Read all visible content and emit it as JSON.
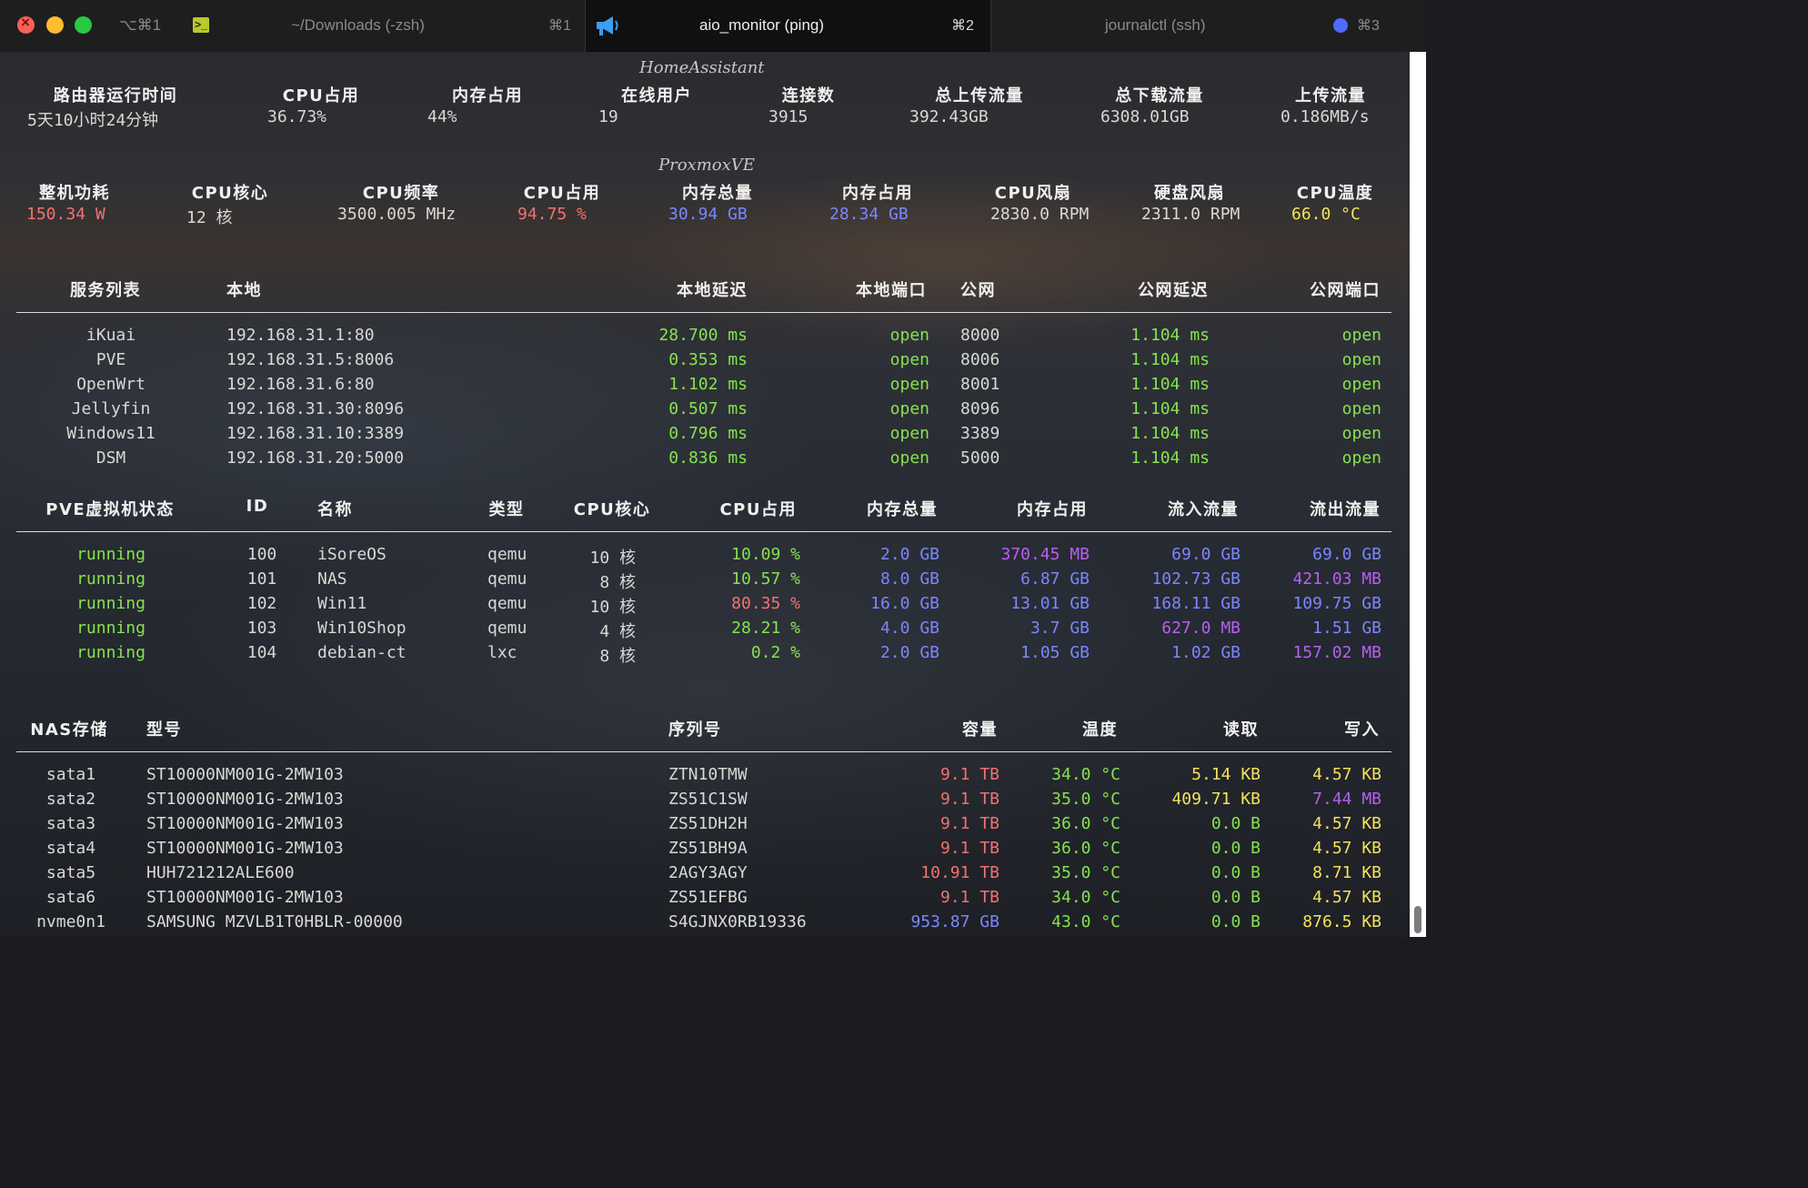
{
  "window": {
    "shortcut": "⌥⌘1",
    "tabs": [
      {
        "title": "~/Downloads (-zsh)",
        "shortcut": "⌘1",
        "active": false
      },
      {
        "title": "aio_monitor (ping)",
        "shortcut": "⌘2",
        "active": true
      },
      {
        "title": "journalctl (ssh)",
        "shortcut": "⌘3",
        "active": false
      }
    ]
  },
  "homeassistant": {
    "title": "HomeAssistant",
    "headers": [
      "路由器运行时间",
      "CPU占用",
      "内存占用",
      "在线用户",
      "连接数",
      "总上传流量",
      "总下载流量",
      "上传流量"
    ],
    "values": [
      "5天10小时24分钟",
      "36.73%",
      "44%",
      "19",
      "3915",
      "392.43GB",
      "6308.01GB",
      "0.186MB/s"
    ]
  },
  "proxmox": {
    "title": "ProxmoxVE",
    "headers": [
      "整机功耗",
      "CPU核心",
      "CPU频率",
      "CPU占用",
      "内存总量",
      "内存占用",
      "CPU风扇",
      "硬盘风扇",
      "CPU温度"
    ],
    "values": [
      "150.34 W",
      "12 核",
      "3500.005 MHz",
      "94.75 %",
      "30.94 GB",
      "28.34 GB",
      "2830.0 RPM",
      "2311.0 RPM",
      "66.0 °C"
    ],
    "colors": [
      "#f07272",
      "#d8d8d4",
      "#d8d8d4",
      "#f07272",
      "#7b87ff",
      "#7b87ff",
      "#d8d8d4",
      "#d8d8d4",
      "#f4e35a"
    ]
  },
  "services": {
    "headers": [
      "服务列表",
      "本地",
      "本地延迟",
      "本地端口",
      "公网",
      "公网延迟",
      "公网端口"
    ],
    "rows": [
      [
        "iKuai",
        "192.168.31.1:80",
        "28.700 ms",
        "open",
        "8000",
        "1.104 ms",
        "open"
      ],
      [
        "PVE",
        "192.168.31.5:8006",
        "0.353 ms",
        "open",
        "8006",
        "1.104 ms",
        "open"
      ],
      [
        "OpenWrt",
        "192.168.31.6:80",
        "1.102 ms",
        "open",
        "8001",
        "1.104 ms",
        "open"
      ],
      [
        "Jellyfin",
        "192.168.31.30:8096",
        "0.507 ms",
        "open",
        "8096",
        "1.104 ms",
        "open"
      ],
      [
        "Windows11",
        "192.168.31.10:3389",
        "0.796 ms",
        "open",
        "3389",
        "1.104 ms",
        "open"
      ],
      [
        "DSM",
        "192.168.31.20:5000",
        "0.836 ms",
        "open",
        "5000",
        "1.104 ms",
        "open"
      ]
    ]
  },
  "vms": {
    "headers": [
      "PVE虚拟机状态",
      "ID",
      "名称",
      "类型",
      "CPU核心",
      "CPU占用",
      "内存总量",
      "内存占用",
      "流入流量",
      "流出流量"
    ],
    "rows": [
      [
        "running",
        "100",
        "iSoreOS",
        "qemu",
        "10 核",
        "10.09 %",
        "2.0 GB",
        "370.45 MB",
        "69.0 GB",
        "69.0 GB"
      ],
      [
        "running",
        "101",
        "NAS",
        "qemu",
        "8 核",
        "10.57 %",
        "8.0 GB",
        "6.87 GB",
        "102.73 GB",
        "421.03 MB"
      ],
      [
        "running",
        "102",
        "Win11",
        "qemu",
        "10 核",
        "80.35 %",
        "16.0 GB",
        "13.01 GB",
        "168.11 GB",
        "109.75 GB"
      ],
      [
        "running",
        "103",
        "Win10Shop",
        "qemu",
        "4 核",
        "28.21 %",
        "4.0 GB",
        "3.7 GB",
        "627.0 MB",
        "1.51 GB"
      ],
      [
        "running",
        "104",
        "debian-ct",
        "lxc",
        "8 核",
        "0.2 %",
        "2.0 GB",
        "1.05 GB",
        "1.02 GB",
        "157.02 MB"
      ]
    ],
    "cpu_colors": [
      "#86e34e",
      "#86e34e",
      "#f07272",
      "#86e34e",
      "#86e34e"
    ],
    "mem_used_colors": [
      "#b75ff0",
      "#7b87ff",
      "#7b87ff",
      "#7b87ff",
      "#7b87ff"
    ],
    "in_colors": [
      "#7b87ff",
      "#7b87ff",
      "#7b87ff",
      "#b75ff0",
      "#7b87ff"
    ],
    "out_colors": [
      "#7b87ff",
      "#b75ff0",
      "#7b87ff",
      "#7b87ff",
      "#b75ff0"
    ]
  },
  "nas": {
    "headers": [
      "NAS存储",
      "型号",
      "序列号",
      "容量",
      "温度",
      "读取",
      "写入"
    ],
    "rows": [
      [
        "sata1",
        "ST10000NM001G-2MW103",
        "ZTN10TMW",
        "9.1 TB",
        "34.0 °C",
        "5.14 KB",
        "4.57 KB"
      ],
      [
        "sata2",
        "ST10000NM001G-2MW103",
        "ZS51C1SW",
        "9.1 TB",
        "35.0 °C",
        "409.71 KB",
        "7.44 MB"
      ],
      [
        "sata3",
        "ST10000NM001G-2MW103",
        "ZS51DH2H",
        "9.1 TB",
        "36.0 °C",
        "0.0 B",
        "4.57 KB"
      ],
      [
        "sata4",
        "ST10000NM001G-2MW103",
        "ZS51BH9A",
        "9.1 TB",
        "36.0 °C",
        "0.0 B",
        "4.57 KB"
      ],
      [
        "sata5",
        "HUH721212ALE600",
        "2AGY3AGY",
        "10.91 TB",
        "35.0 °C",
        "0.0 B",
        "8.71 KB"
      ],
      [
        "sata6",
        "ST10000NM001G-2MW103",
        "ZS51EFBG",
        "9.1 TB",
        "34.0 °C",
        "0.0 B",
        "4.57 KB"
      ],
      [
        "nvme0n1",
        "SAMSUNG MZVLB1T0HBLR-00000",
        "S4GJNX0RB19336",
        "953.87 GB",
        "43.0 °C",
        "0.0 B",
        "876.5 KB"
      ]
    ],
    "cap_colors": [
      "#f07272",
      "#f07272",
      "#f07272",
      "#f07272",
      "#f07272",
      "#f07272",
      "#7b87ff"
    ],
    "read_colors": [
      "#f4e35a",
      "#f4e35a",
      "#86e34e",
      "#86e34e",
      "#86e34e",
      "#86e34e",
      "#86e34e"
    ],
    "write_colors": [
      "#f4e35a",
      "#b75ff0",
      "#f4e35a",
      "#f4e35a",
      "#f4e35a",
      "#f4e35a",
      "#f4e35a"
    ]
  }
}
